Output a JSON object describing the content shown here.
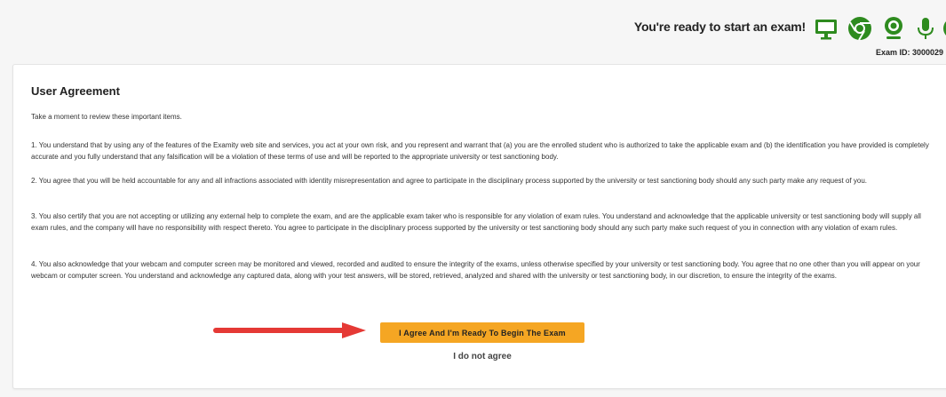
{
  "header": {
    "ready_text": "You're ready to start an exam!",
    "exam_id": "Exam ID: 3000029",
    "status_icons": [
      "monitor-icon",
      "chrome-icon",
      "webcam-icon",
      "microphone-icon",
      "palette-icon"
    ],
    "icon_color": "#2e8b1f"
  },
  "agreement": {
    "title": "User Agreement",
    "intro": "Take a moment to review these important items.",
    "items": [
      "1. You understand that by using any of the features of the Examity web site and services, you act at your own risk, and you represent and warrant that (a) you are the enrolled student who is authorized to take the applicable exam and (b) the identification you have provided is completely accurate and you fully understand that any falsification will be a violation of these terms of use and will be reported to the appropriate university or test sanctioning body.",
      "2. You agree that you will be held accountable for any and all infractions associated with identity misrepresentation and agree to participate in the disciplinary process supported by the university or test sanctioning body should any such party make any request of you.",
      "3. You also certify that you are not accepting or utilizing any external help to complete the exam, and are the applicable exam taker who is responsible for any violation of exam rules. You understand and acknowledge that the applicable university or test sanctioning body will supply all exam rules, and the company will have no responsibility with respect thereto. You agree to participate in the disciplinary process supported by the university or test sanctioning body should any such party make such request of you in connection with any violation of exam rules.",
      "4. You also acknowledge that your webcam and computer screen may be monitored and viewed, recorded and audited to ensure the integrity of the exams, unless otherwise specified by your university or test sanctioning body. You agree that no one other than you will appear on your webcam or computer screen. You understand and acknowledge any captured data, along with your test answers, will be stored, retrieved, analyzed and shared with the university or test sanctioning body, in our discretion, to ensure the integrity of the exams."
    ],
    "agree_label": "I Agree And I'm Ready To Begin The Exam",
    "disagree_label": "I do not agree",
    "accent_color": "#f5a623",
    "arrow_color": "#e53935"
  }
}
